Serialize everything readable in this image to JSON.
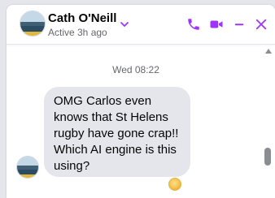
{
  "header": {
    "name": "Cath O'Neill",
    "status": "Active 3h ago",
    "avatar_icon": "profile-photo",
    "accent_color": "#a033ff",
    "actions": [
      "phone-icon",
      "video-camera-icon",
      "minimize-icon",
      "close-icon"
    ]
  },
  "thread": {
    "timestamp": "Wed 08:22",
    "messages": [
      {
        "lines": [
          "OMG Carlos even",
          "knows that St Helens",
          "rugby have gone crap!!",
          "Which AI engine is this",
          "using?"
        ],
        "bubble_color": "#e4e6eb"
      }
    ],
    "seen_indicator_icon": "seen-avatar-icon"
  }
}
